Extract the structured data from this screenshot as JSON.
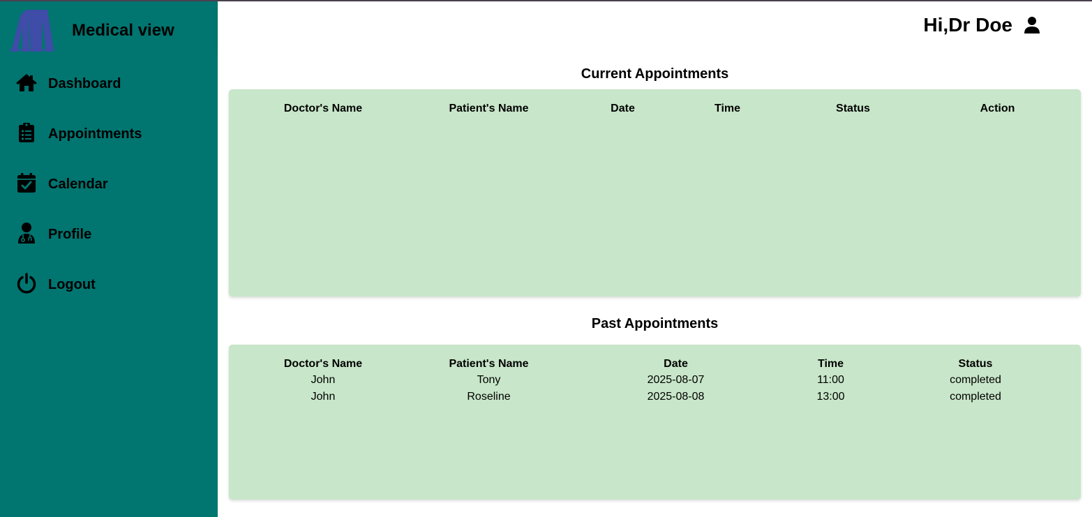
{
  "brand": {
    "name": "Medical view",
    "logo_color": "#3f4ca8"
  },
  "sidebar": {
    "bg_color": "#017570",
    "items": [
      {
        "label": "Dashboard",
        "icon": "home-icon"
      },
      {
        "label": "Appointments",
        "icon": "clipboard-icon"
      },
      {
        "label": "Calendar",
        "icon": "calendar-check-icon"
      },
      {
        "label": "Profile",
        "icon": "doctor-icon"
      },
      {
        "label": "Logout",
        "icon": "power-icon"
      }
    ]
  },
  "header": {
    "greeting": "Hi,Dr Doe",
    "icon": "user-icon"
  },
  "current": {
    "title": "Current Appointments",
    "panel_color": "#c8e6c9",
    "columns": [
      "Doctor's Name",
      "Patient's Name",
      "Date",
      "Time",
      "Status",
      "Action"
    ],
    "rows": []
  },
  "past": {
    "title": "Past Appointments",
    "columns": [
      "Doctor's Name",
      "Patient's Name",
      "Date",
      "Time",
      "Status"
    ],
    "rows": [
      [
        "John",
        "Tony",
        "2025-08-07",
        "11:00",
        "completed"
      ],
      [
        "John",
        "Roseline",
        "2025-08-08",
        "13:00",
        "completed"
      ]
    ]
  }
}
